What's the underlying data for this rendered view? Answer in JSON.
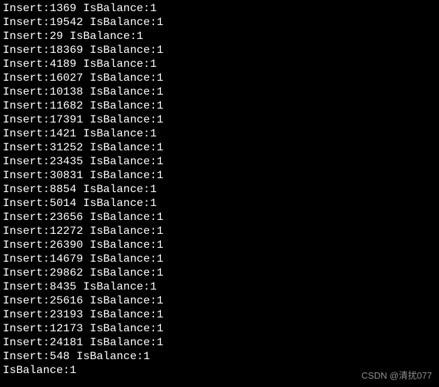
{
  "terminal": {
    "lines": [
      {
        "insert_label": "Insert:",
        "insert_value": "1369",
        "balance_label": "IsBalance:",
        "balance_value": "1"
      },
      {
        "insert_label": "Insert:",
        "insert_value": "19542",
        "balance_label": "IsBalance:",
        "balance_value": "1"
      },
      {
        "insert_label": "Insert:",
        "insert_value": "29",
        "balance_label": "IsBalance:",
        "balance_value": "1"
      },
      {
        "insert_label": "Insert:",
        "insert_value": "18369",
        "balance_label": "IsBalance:",
        "balance_value": "1"
      },
      {
        "insert_label": "Insert:",
        "insert_value": "4189",
        "balance_label": "IsBalance:",
        "balance_value": "1"
      },
      {
        "insert_label": "Insert:",
        "insert_value": "16027",
        "balance_label": "IsBalance:",
        "balance_value": "1"
      },
      {
        "insert_label": "Insert:",
        "insert_value": "10138",
        "balance_label": "IsBalance:",
        "balance_value": "1"
      },
      {
        "insert_label": "Insert:",
        "insert_value": "11682",
        "balance_label": "IsBalance:",
        "balance_value": "1"
      },
      {
        "insert_label": "Insert:",
        "insert_value": "17391",
        "balance_label": "IsBalance:",
        "balance_value": "1"
      },
      {
        "insert_label": "Insert:",
        "insert_value": "1421",
        "balance_label": "IsBalance:",
        "balance_value": "1"
      },
      {
        "insert_label": "Insert:",
        "insert_value": "31252",
        "balance_label": "IsBalance:",
        "balance_value": "1"
      },
      {
        "insert_label": "Insert:",
        "insert_value": "23435",
        "balance_label": "IsBalance:",
        "balance_value": "1"
      },
      {
        "insert_label": "Insert:",
        "insert_value": "30831",
        "balance_label": "IsBalance:",
        "balance_value": "1"
      },
      {
        "insert_label": "Insert:",
        "insert_value": "8854",
        "balance_label": "IsBalance:",
        "balance_value": "1"
      },
      {
        "insert_label": "Insert:",
        "insert_value": "5014",
        "balance_label": "IsBalance:",
        "balance_value": "1"
      },
      {
        "insert_label": "Insert:",
        "insert_value": "23656",
        "balance_label": "IsBalance:",
        "balance_value": "1"
      },
      {
        "insert_label": "Insert:",
        "insert_value": "12272",
        "balance_label": "IsBalance:",
        "balance_value": "1"
      },
      {
        "insert_label": "Insert:",
        "insert_value": "26390",
        "balance_label": "IsBalance:",
        "balance_value": "1"
      },
      {
        "insert_label": "Insert:",
        "insert_value": "14679",
        "balance_label": "IsBalance:",
        "balance_value": "1"
      },
      {
        "insert_label": "Insert:",
        "insert_value": "29862",
        "balance_label": "IsBalance:",
        "balance_value": "1"
      },
      {
        "insert_label": "Insert:",
        "insert_value": "8435",
        "balance_label": "IsBalance:",
        "balance_value": "1"
      },
      {
        "insert_label": "Insert:",
        "insert_value": "25616",
        "balance_label": "IsBalance:",
        "balance_value": "1"
      },
      {
        "insert_label": "Insert:",
        "insert_value": "23193",
        "balance_label": "IsBalance:",
        "balance_value": "1"
      },
      {
        "insert_label": "Insert:",
        "insert_value": "12173",
        "balance_label": "IsBalance:",
        "balance_value": "1"
      },
      {
        "insert_label": "Insert:",
        "insert_value": "24181",
        "balance_label": "IsBalance:",
        "balance_value": "1"
      },
      {
        "insert_label": "Insert:",
        "insert_value": "548",
        "balance_label": "IsBalance:",
        "balance_value": "1"
      }
    ],
    "final_line": {
      "balance_label": "IsBalance:",
      "balance_value": "1"
    }
  },
  "watermark": "CSDN @清扰077"
}
